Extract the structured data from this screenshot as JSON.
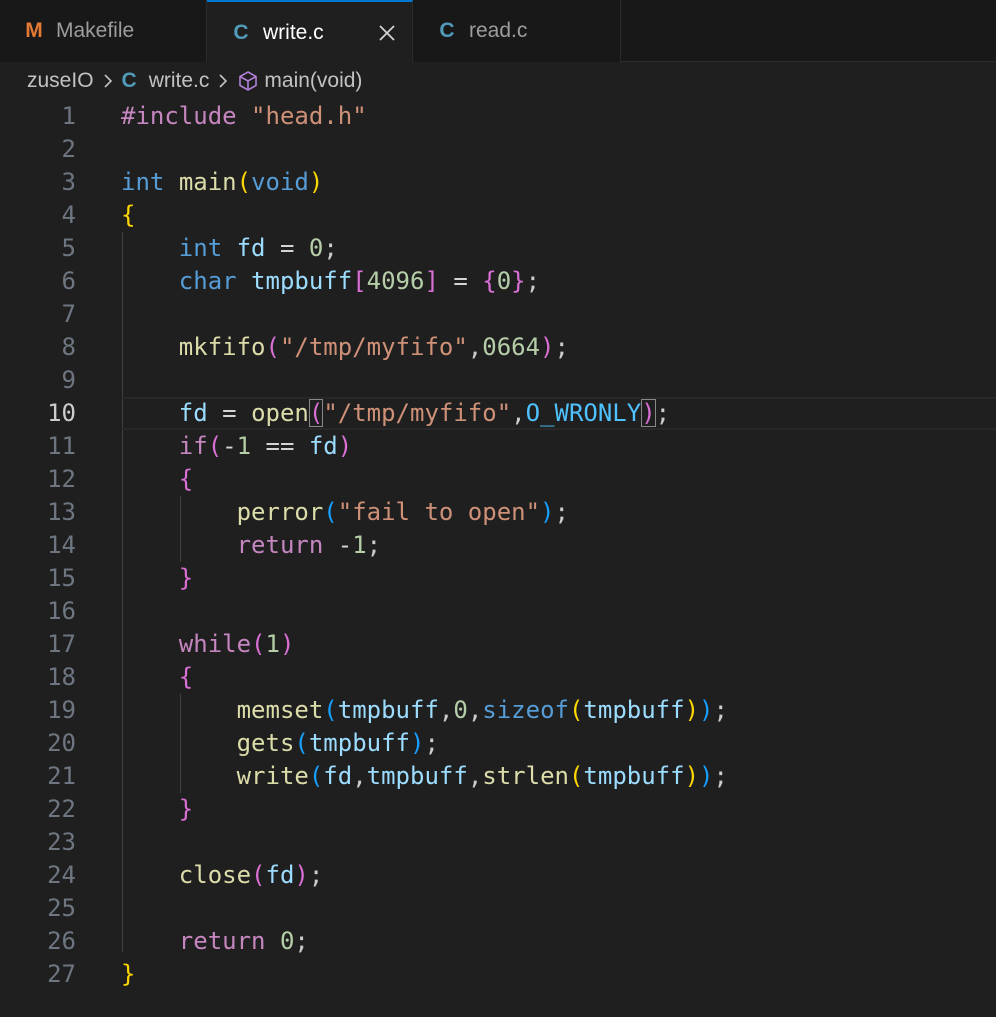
{
  "tabs": [
    {
      "label": "Makefile",
      "icon": "makefile-icon",
      "glyph": "M",
      "color": "#e37933"
    },
    {
      "label": "write.c",
      "icon": "c-file-icon",
      "glyph": "C",
      "color": "#519aba",
      "active": true
    },
    {
      "label": "read.c",
      "icon": "c-file-icon",
      "glyph": "C",
      "color": "#519aba"
    }
  ],
  "breadcrumb": {
    "folder": "zuseIO",
    "file": "write.c",
    "file_glyph": "C",
    "symbol": "main(void)"
  },
  "editor": {
    "current_line": 10,
    "lines": [
      [
        [
          "ctl",
          "#include "
        ],
        [
          "str",
          "\"head.h\""
        ]
      ],
      [],
      [
        [
          "kw",
          "int"
        ],
        [
          "p",
          " "
        ],
        [
          "fn",
          "main"
        ],
        [
          "b1",
          "("
        ],
        [
          "kw",
          "void"
        ],
        [
          "b1",
          ")"
        ]
      ],
      [
        [
          "b1",
          "{"
        ]
      ],
      [
        [
          "p",
          "    "
        ],
        [
          "kw",
          "int"
        ],
        [
          "p",
          " "
        ],
        [
          "var",
          "fd"
        ],
        [
          "op",
          " = "
        ],
        [
          "num",
          "0"
        ],
        [
          "p",
          ";"
        ]
      ],
      [
        [
          "p",
          "    "
        ],
        [
          "kw",
          "char"
        ],
        [
          "p",
          " "
        ],
        [
          "var",
          "tmpbuff"
        ],
        [
          "b2",
          "["
        ],
        [
          "num",
          "4096"
        ],
        [
          "b2",
          "]"
        ],
        [
          "op",
          " = "
        ],
        [
          "b2",
          "{"
        ],
        [
          "num",
          "0"
        ],
        [
          "b2",
          "}"
        ],
        [
          "p",
          ";"
        ]
      ],
      [],
      [
        [
          "p",
          "    "
        ],
        [
          "fn",
          "mkfifo"
        ],
        [
          "b2",
          "("
        ],
        [
          "str",
          "\"/tmp/myfifo\""
        ],
        [
          "p",
          ","
        ],
        [
          "num",
          "0664"
        ],
        [
          "b2",
          ")"
        ],
        [
          "p",
          ";"
        ]
      ],
      [],
      [
        [
          "p",
          "    "
        ],
        [
          "var",
          "fd"
        ],
        [
          "op",
          " = "
        ],
        [
          "fn",
          "open"
        ],
        [
          "b2m",
          "("
        ],
        [
          "str",
          "\"/tmp/myfifo\""
        ],
        [
          "p",
          ","
        ],
        [
          "const",
          "O_WRONLY"
        ],
        [
          "b2m",
          ")"
        ],
        [
          "p",
          ";"
        ]
      ],
      [
        [
          "p",
          "    "
        ],
        [
          "ctl",
          "if"
        ],
        [
          "b2",
          "("
        ],
        [
          "op",
          "-"
        ],
        [
          "num",
          "1"
        ],
        [
          "op",
          " == "
        ],
        [
          "var",
          "fd"
        ],
        [
          "b2",
          ")"
        ]
      ],
      [
        [
          "p",
          "    "
        ],
        [
          "b2",
          "{"
        ]
      ],
      [
        [
          "p",
          "        "
        ],
        [
          "fn",
          "perror"
        ],
        [
          "b3",
          "("
        ],
        [
          "str",
          "\"fail to open\""
        ],
        [
          "b3",
          ")"
        ],
        [
          "p",
          ";"
        ]
      ],
      [
        [
          "p",
          "        "
        ],
        [
          "ctl",
          "return"
        ],
        [
          "op",
          " -"
        ],
        [
          "num",
          "1"
        ],
        [
          "p",
          ";"
        ]
      ],
      [
        [
          "p",
          "    "
        ],
        [
          "b2",
          "}"
        ]
      ],
      [],
      [
        [
          "p",
          "    "
        ],
        [
          "ctl",
          "while"
        ],
        [
          "b2",
          "("
        ],
        [
          "num",
          "1"
        ],
        [
          "b2",
          ")"
        ]
      ],
      [
        [
          "p",
          "    "
        ],
        [
          "b2",
          "{"
        ]
      ],
      [
        [
          "p",
          "        "
        ],
        [
          "fn",
          "memset"
        ],
        [
          "b3",
          "("
        ],
        [
          "var",
          "tmpbuff"
        ],
        [
          "p",
          ","
        ],
        [
          "num",
          "0"
        ],
        [
          "p",
          ","
        ],
        [
          "kw",
          "sizeof"
        ],
        [
          "b1",
          "("
        ],
        [
          "var",
          "tmpbuff"
        ],
        [
          "b1",
          ")"
        ],
        [
          "b3",
          ")"
        ],
        [
          "p",
          ";"
        ]
      ],
      [
        [
          "p",
          "        "
        ],
        [
          "fn",
          "gets"
        ],
        [
          "b3",
          "("
        ],
        [
          "var",
          "tmpbuff"
        ],
        [
          "b3",
          ")"
        ],
        [
          "p",
          ";"
        ]
      ],
      [
        [
          "p",
          "        "
        ],
        [
          "fn",
          "write"
        ],
        [
          "b3",
          "("
        ],
        [
          "var",
          "fd"
        ],
        [
          "p",
          ","
        ],
        [
          "var",
          "tmpbuff"
        ],
        [
          "p",
          ","
        ],
        [
          "fn",
          "strlen"
        ],
        [
          "b1",
          "("
        ],
        [
          "var",
          "tmpbuff"
        ],
        [
          "b1",
          ")"
        ],
        [
          "b3",
          ")"
        ],
        [
          "p",
          ";"
        ]
      ],
      [
        [
          "p",
          "    "
        ],
        [
          "b2",
          "}"
        ]
      ],
      [],
      [
        [
          "p",
          "    "
        ],
        [
          "fn",
          "close"
        ],
        [
          "b2",
          "("
        ],
        [
          "var",
          "fd"
        ],
        [
          "b2",
          ")"
        ],
        [
          "p",
          ";"
        ]
      ],
      [],
      [
        [
          "p",
          "    "
        ],
        [
          "ctl",
          "return"
        ],
        [
          "p",
          " "
        ],
        [
          "num",
          "0"
        ],
        [
          "p",
          ";"
        ]
      ],
      [
        [
          "b1",
          "}"
        ]
      ]
    ]
  }
}
